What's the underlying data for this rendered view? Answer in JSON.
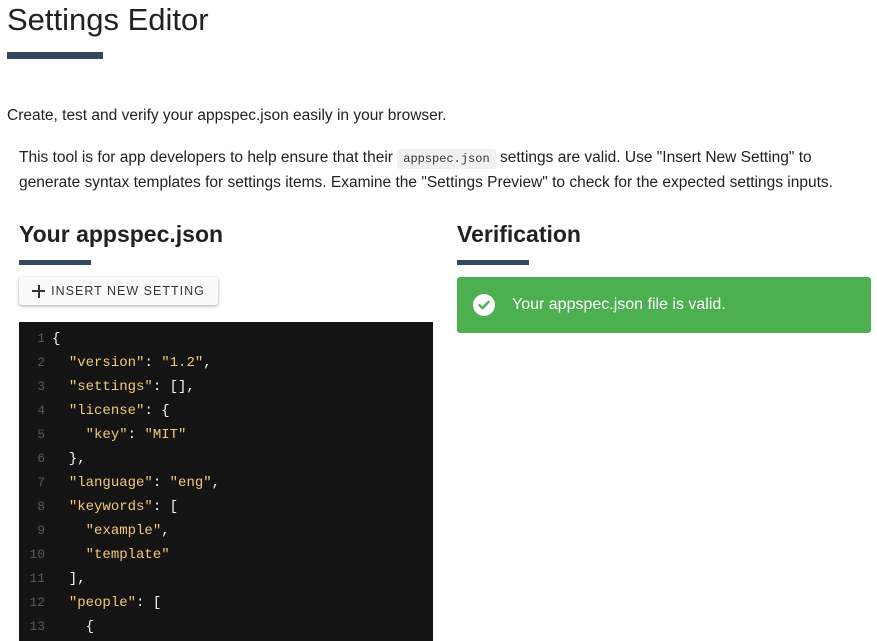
{
  "page": {
    "title": "Settings Editor",
    "tagline": "Create, test and verify your appspec.json easily in your browser.",
    "intro": {
      "before": "This tool is for app developers to help ensure that their ",
      "code": "appspec.json",
      "after": " settings are valid. Use \"Insert New Setting\" to generate syntax templates for settings items. Examine the \"Settings Preview\" to check for the expected settings inputs."
    }
  },
  "editor_panel": {
    "heading": "Your appspec.json",
    "insert_button_label": "INSERT NEW SETTING",
    "insert_button_icon": "plus-icon",
    "lines": [
      {
        "n": "1",
        "tokens": [
          {
            "t": "p",
            "v": "{"
          }
        ]
      },
      {
        "n": "2",
        "tokens": [
          {
            "t": "p",
            "v": "  "
          },
          {
            "t": "key",
            "v": "\"version\""
          },
          {
            "t": "p",
            "v": ": "
          },
          {
            "t": "str",
            "v": "\"1.2\""
          },
          {
            "t": "p",
            "v": ","
          }
        ]
      },
      {
        "n": "3",
        "tokens": [
          {
            "t": "p",
            "v": "  "
          },
          {
            "t": "key",
            "v": "\"settings\""
          },
          {
            "t": "p",
            "v": ": [],"
          }
        ]
      },
      {
        "n": "4",
        "tokens": [
          {
            "t": "p",
            "v": "  "
          },
          {
            "t": "key",
            "v": "\"license\""
          },
          {
            "t": "p",
            "v": ": {"
          }
        ]
      },
      {
        "n": "5",
        "tokens": [
          {
            "t": "p",
            "v": "    "
          },
          {
            "t": "key",
            "v": "\"key\""
          },
          {
            "t": "p",
            "v": ": "
          },
          {
            "t": "str",
            "v": "\"MIT\""
          }
        ]
      },
      {
        "n": "6",
        "tokens": [
          {
            "t": "p",
            "v": "  },"
          }
        ]
      },
      {
        "n": "7",
        "tokens": [
          {
            "t": "p",
            "v": "  "
          },
          {
            "t": "key",
            "v": "\"language\""
          },
          {
            "t": "p",
            "v": ": "
          },
          {
            "t": "str",
            "v": "\"eng\""
          },
          {
            "t": "p",
            "v": ","
          }
        ]
      },
      {
        "n": "8",
        "tokens": [
          {
            "t": "p",
            "v": "  "
          },
          {
            "t": "key",
            "v": "\"keywords\""
          },
          {
            "t": "p",
            "v": ": ["
          }
        ]
      },
      {
        "n": "9",
        "tokens": [
          {
            "t": "p",
            "v": "    "
          },
          {
            "t": "str",
            "v": "\"example\""
          },
          {
            "t": "p",
            "v": ","
          }
        ]
      },
      {
        "n": "10",
        "tokens": [
          {
            "t": "p",
            "v": "    "
          },
          {
            "t": "str",
            "v": "\"template\""
          }
        ]
      },
      {
        "n": "11",
        "tokens": [
          {
            "t": "p",
            "v": "  ],"
          }
        ]
      },
      {
        "n": "12",
        "tokens": [
          {
            "t": "p",
            "v": "  "
          },
          {
            "t": "key",
            "v": "\"people\""
          },
          {
            "t": "p",
            "v": ": ["
          }
        ]
      },
      {
        "n": "13",
        "tokens": [
          {
            "t": "p",
            "v": "    {"
          }
        ]
      }
    ]
  },
  "verification_panel": {
    "heading": "Verification",
    "status_text": "Your appspec.json file is valid.",
    "status_icon": "check-circle-icon",
    "status_color": "#4caf50"
  },
  "colors": {
    "accent_underline": "#34495e",
    "editor_background": "#141414",
    "editor_token": "#f4c97a"
  }
}
